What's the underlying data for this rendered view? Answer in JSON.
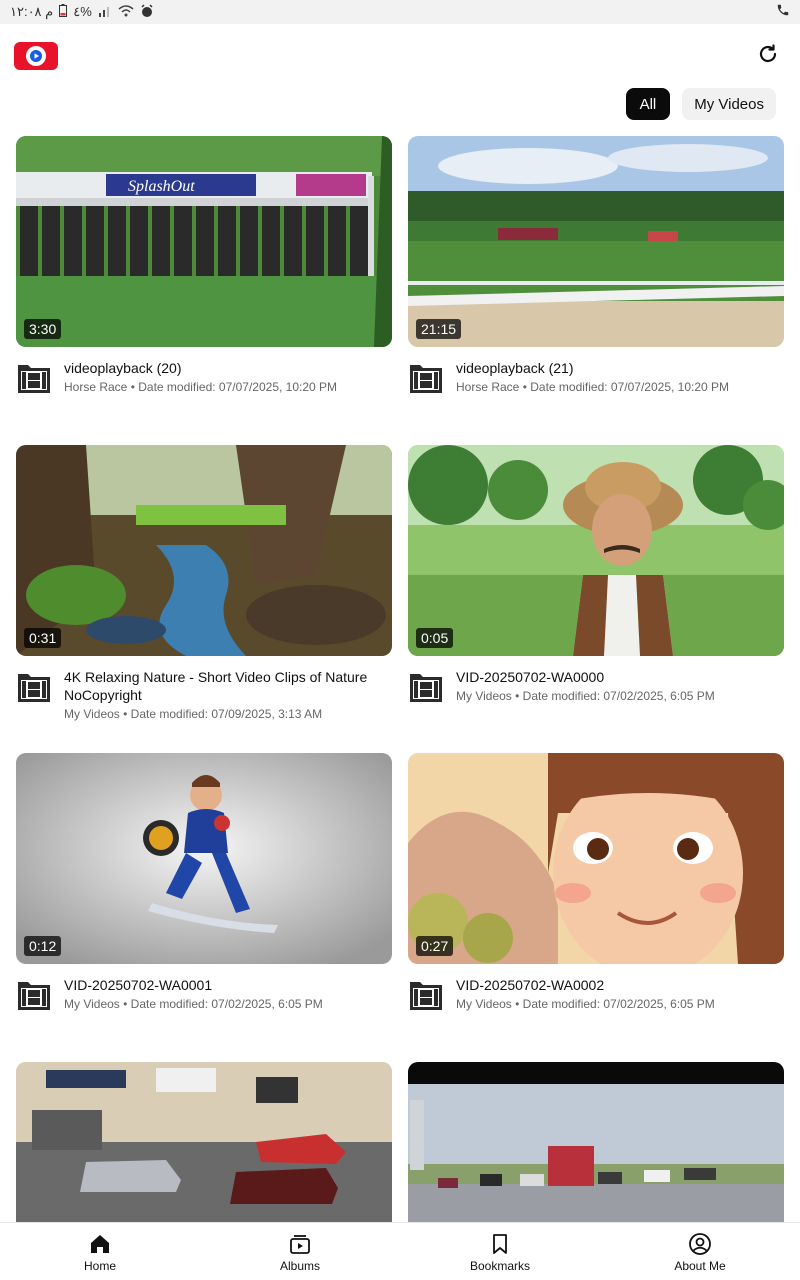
{
  "status_bar": {
    "time": "۱۲:۰۸ م",
    "battery": "٤%",
    "call_icon": "call-icon"
  },
  "app": {
    "logo_icon": "video-player-logo",
    "refresh_icon": "refresh-icon"
  },
  "filters": {
    "all_label": "All",
    "my_videos_label": "My Videos",
    "selected": "All"
  },
  "videos": [
    {
      "title": "videoplayback (20)",
      "subtitle": "Horse Race • Date modified: 07/07/2025, 10:20 PM",
      "duration": "3:30"
    },
    {
      "title": "videoplayback (21)",
      "subtitle": "Horse Race • Date modified: 07/07/2025, 10:20 PM",
      "duration": "21:15"
    },
    {
      "title": "4K Relaxing Nature - Short Video Clips of Nature NoCopyright",
      "subtitle": "My Videos • Date modified: 07/09/2025, 3:13 AM",
      "duration": "0:31"
    },
    {
      "title": "VID-20250702-WA0000",
      "subtitle": "My Videos • Date modified: 07/02/2025, 6:05 PM",
      "duration": "0:05"
    },
    {
      "title": "VID-20250702-WA0001",
      "subtitle": "My Videos • Date modified: 07/02/2025, 6:05 PM",
      "duration": "0:12"
    },
    {
      "title": "VID-20250702-WA0002",
      "subtitle": "My Videos • Date modified: 07/02/2025, 6:05 PM",
      "duration": "0:27"
    }
  ],
  "nav": {
    "home": "Home",
    "albums": "Albums",
    "bookmarks": "Bookmarks",
    "about": "About Me",
    "active": "Home"
  },
  "colors": {
    "brand_red": "#e8132b",
    "chip_active_bg": "#0b0b0b",
    "chip_inactive_bg": "#f1f1f1"
  }
}
